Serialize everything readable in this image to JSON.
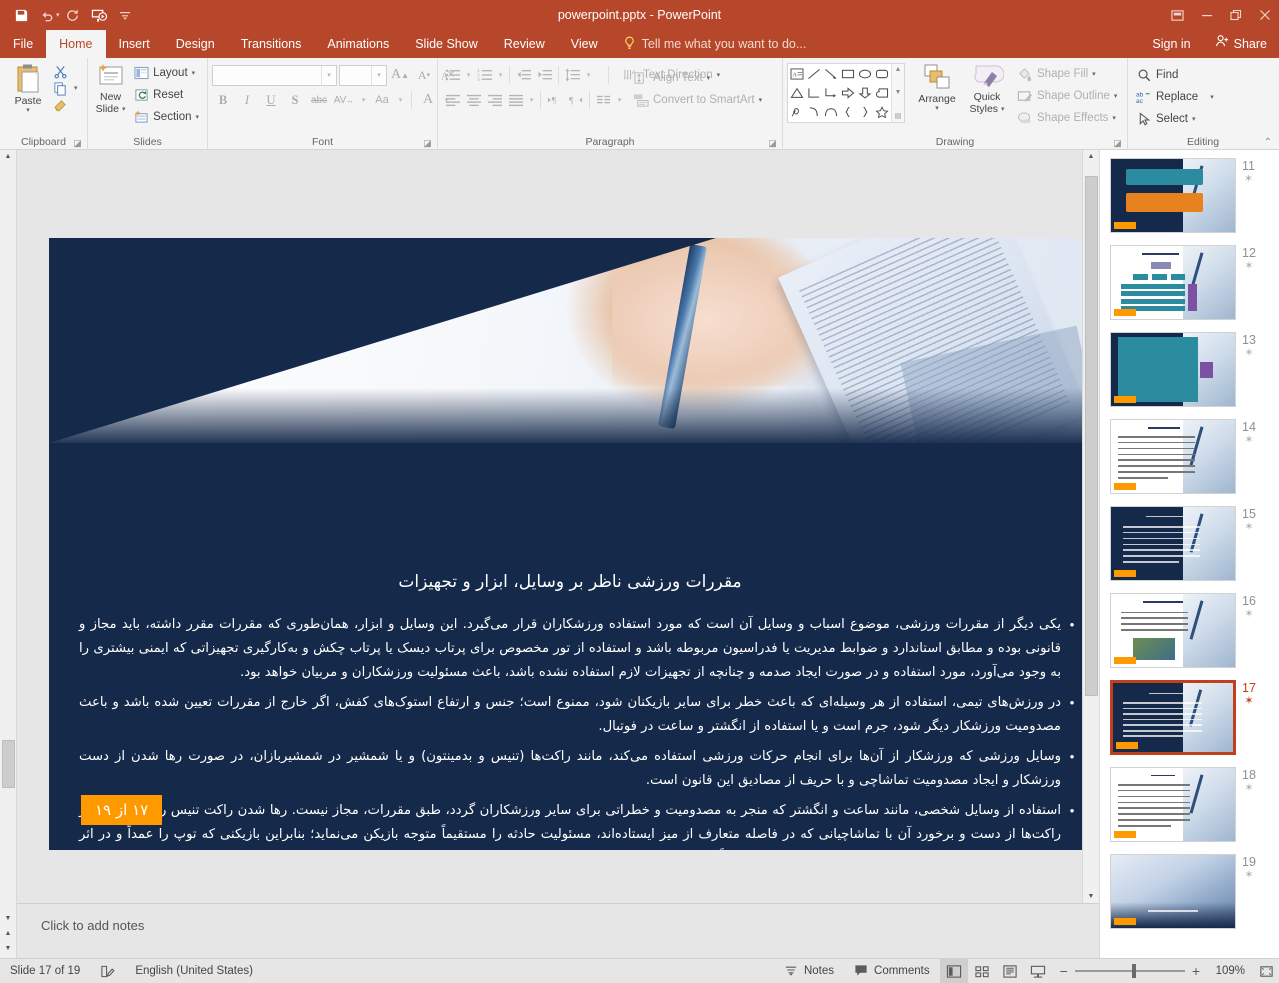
{
  "window": {
    "title": "powerpoint.pptx - PowerPoint",
    "quick_access": [
      "save-icon",
      "undo-icon",
      "redo-icon",
      "start-presentation-icon",
      "customize-qat-icon"
    ],
    "controls": [
      "ribbon-display-options-icon",
      "minimize-icon",
      "restore-icon",
      "close-icon"
    ]
  },
  "tabs": [
    {
      "label": "File",
      "active": false
    },
    {
      "label": "Home",
      "active": true
    },
    {
      "label": "Insert",
      "active": false
    },
    {
      "label": "Design",
      "active": false
    },
    {
      "label": "Transitions",
      "active": false
    },
    {
      "label": "Animations",
      "active": false
    },
    {
      "label": "Slide Show",
      "active": false
    },
    {
      "label": "Review",
      "active": false
    },
    {
      "label": "View",
      "active": false
    }
  ],
  "tell_me": "Tell me what you want to do...",
  "account": {
    "sign_in": "Sign in",
    "share": "Share"
  },
  "ribbon": {
    "clipboard": {
      "label": "Clipboard",
      "paste": "Paste",
      "cut": "Cut",
      "copy": "Copy",
      "format_painter": "Format Painter"
    },
    "slides": {
      "label": "Slides",
      "new_slide": "New\nSlide",
      "new_slide_line1": "New",
      "new_slide_line2": "Slide",
      "layout": "Layout",
      "reset": "Reset",
      "section": "Section"
    },
    "font": {
      "label": "Font",
      "font_name": "",
      "font_name_placeholder": "",
      "font_size": "",
      "increase_size": "A",
      "decrease_size": "A",
      "clear_formatting": "Clear All Formatting",
      "bold": "B",
      "italic": "I",
      "underline": "U",
      "shadow": "S",
      "strikethrough": "abc",
      "character_spacing": "AV",
      "change_case": "Aa",
      "font_color": "A"
    },
    "paragraph": {
      "label": "Paragraph",
      "text_direction": "Text Direction",
      "align_text": "Align Text",
      "convert_to_smartart": "Convert to SmartArt"
    },
    "drawing": {
      "label": "Drawing",
      "arrange": "Arrange",
      "quick_styles_line1": "Quick",
      "quick_styles_line2": "Styles",
      "shape_fill": "Shape Fill",
      "shape_outline": "Shape Outline",
      "shape_effects": "Shape Effects"
    },
    "editing": {
      "label": "Editing",
      "find": "Find",
      "replace": "Replace",
      "select": "Select"
    }
  },
  "slide": {
    "title": "مقررات ورزشی ناظر بر وسایل، ابزار و تجهیزات",
    "badge": "۱۷ از ۱۹",
    "bullets": [
      "یکی دیگر از مقررات ورزشی، موضوع اسباب و وسایل آن است که مورد استفاده ورزشکاران قرار می‌گیرد. این وسایل و ابزار، همان‌طوری که مقررات مقرر داشته، باید مجاز و قانونی بوده و مطابق استاندارد و ضوابط مدیریت یا فدراسیون مربوطه باشد و استفاده از تور مخصوص برای پرتاب دیسک یا پرتاب چکش و به‌کارگیری تجهیزاتی که ایمنی بیشتری را به وجود می‌آورد، مورد استفاده و در صورت ایجاد صدمه و چنانچه از تجهیزات لازم استفاده نشده باشد، باعث مسئولیت ورزشکاران و مربیان خواهد بود.",
      "در ورزش‌های تیمی، استفاده از هر وسیله‌ای که باعث خطر برای سایر بازیکنان شود، ممنوع است؛ جنس و ارتفاع استوک‌های کفش، اگر خارج از مقررات تعیین شده باشد و باعث مصدومیت ورزشکار دیگر شود، جرم است و یا استفاده از انگشتر و ساعت در فوتبال.",
      "وسایل ورزشی که ورزشکار از آن‌ها برای انجام حرکات ورزشی استفاده می‌کند، مانند راکت‌ها (تنیس و بدمینتون) و یا شمشیر در شمشیربازان، در صورت رها شدن از دست ورزشکار و ایجاد مصدومیت تماشاچی و با حریف از مصادیق این قانون است.",
      "استفاده از وسایل شخصی، مانند ساعت و انگشتر که منجر به مصدومیت و خطراتی برای سایر ورزشکاران گردد، طبق مقررات، مجاز نیست. رها شدن راکت تنیس روی میز و سایر راکت‌ها از دست و برخورد آن با تماشاچیانی که در فاصله متعارف از میز ایستاده‌اند، مسئولیت حادثه را مستقیماً متوجه بازیکن می‌نماید؛ بنابراین بازیکنی که توپ را عمداً و در اثر عصبانیت، به‌طرف تماشاچیان می‌زند، موجب حادثه گردد، قانوناً مجرم است."
    ]
  },
  "notes": {
    "placeholder": "Click to add notes"
  },
  "thumbnails": [
    {
      "number": "11",
      "style": "dark",
      "selected": false
    },
    {
      "number": "12",
      "style": "light-diagram",
      "selected": false
    },
    {
      "number": "13",
      "style": "dark-teal",
      "selected": false
    },
    {
      "number": "14",
      "style": "light-text",
      "selected": false
    },
    {
      "number": "15",
      "style": "dark",
      "selected": false
    },
    {
      "number": "16",
      "style": "light-photo",
      "selected": false
    },
    {
      "number": "17",
      "style": "dark",
      "selected": true
    },
    {
      "number": "18",
      "style": "light-text",
      "selected": false
    },
    {
      "number": "19",
      "style": "photo-full",
      "selected": false
    }
  ],
  "statusbar": {
    "slide_counter": "Slide 17 of 19",
    "language": "English (United States)",
    "notes": "Notes",
    "comments": "Comments",
    "views": [
      "normal-view",
      "slide-sorter-view",
      "reading-view",
      "slide-show-view"
    ],
    "zoom_percent": "109%",
    "zoom_minus": "−",
    "zoom_plus": "+"
  },
  "colors": {
    "brand_red": "#b7472a",
    "slide_navy": "#15294a",
    "badge_orange": "#ff9900",
    "selection_red": "#c0401c"
  }
}
